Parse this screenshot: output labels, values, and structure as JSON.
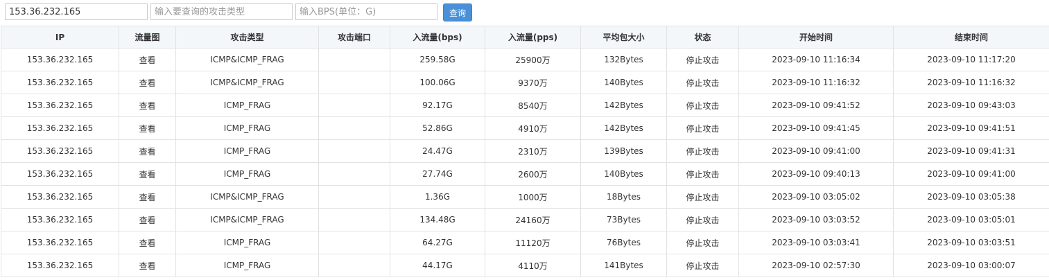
{
  "search": {
    "ip_value": "153.36.232.165",
    "type_placeholder": "输入要查询的攻击类型",
    "bps_placeholder": "输入BPS(单位：G)",
    "query_label": "查询"
  },
  "table": {
    "columns": [
      "IP",
      "流量图",
      "攻击类型",
      "攻击端口",
      "入流量(bps)",
      "入流量(pps)",
      "平均包大小",
      "状态",
      "开始时间",
      "结束时间"
    ],
    "rows": [
      [
        "153.36.232.165",
        "查看",
        "ICMP&ICMP_FRAG",
        "",
        "259.58G",
        "25900万",
        "132Bytes",
        "停止攻击",
        "2023-09-10 11:16:34",
        "2023-09-10 11:17:20"
      ],
      [
        "153.36.232.165",
        "查看",
        "ICMP&ICMP_FRAG",
        "",
        "100.06G",
        "9370万",
        "140Bytes",
        "停止攻击",
        "2023-09-10 11:16:32",
        "2023-09-10 11:16:32"
      ],
      [
        "153.36.232.165",
        "查看",
        "ICMP_FRAG",
        "",
        "92.17G",
        "8540万",
        "142Bytes",
        "停止攻击",
        "2023-09-10 09:41:52",
        "2023-09-10 09:43:03"
      ],
      [
        "153.36.232.165",
        "查看",
        "ICMP_FRAG",
        "",
        "52.86G",
        "4910万",
        "142Bytes",
        "停止攻击",
        "2023-09-10 09:41:45",
        "2023-09-10 09:41:51"
      ],
      [
        "153.36.232.165",
        "查看",
        "ICMP_FRAG",
        "",
        "24.47G",
        "2310万",
        "139Bytes",
        "停止攻击",
        "2023-09-10 09:41:00",
        "2023-09-10 09:41:31"
      ],
      [
        "153.36.232.165",
        "查看",
        "ICMP_FRAG",
        "",
        "27.74G",
        "2600万",
        "140Bytes",
        "停止攻击",
        "2023-09-10 09:40:13",
        "2023-09-10 09:41:00"
      ],
      [
        "153.36.232.165",
        "查看",
        "ICMP&ICMP_FRAG",
        "",
        "1.36G",
        "1000万",
        "18Bytes",
        "停止攻击",
        "2023-09-10 03:05:02",
        "2023-09-10 03:05:38"
      ],
      [
        "153.36.232.165",
        "查看",
        "ICMP&ICMP_FRAG",
        "",
        "134.48G",
        "24160万",
        "73Bytes",
        "停止攻击",
        "2023-09-10 03:03:52",
        "2023-09-10 03:05:01"
      ],
      [
        "153.36.232.165",
        "查看",
        "ICMP_FRAG",
        "",
        "64.27G",
        "11120万",
        "76Bytes",
        "停止攻击",
        "2023-09-10 03:03:41",
        "2023-09-10 03:03:51"
      ],
      [
        "153.36.232.165",
        "查看",
        "ICMP_FRAG",
        "",
        "44.17G",
        "4110万",
        "141Bytes",
        "停止攻击",
        "2023-09-10 02:57:30",
        "2023-09-10 03:00:07"
      ]
    ]
  }
}
